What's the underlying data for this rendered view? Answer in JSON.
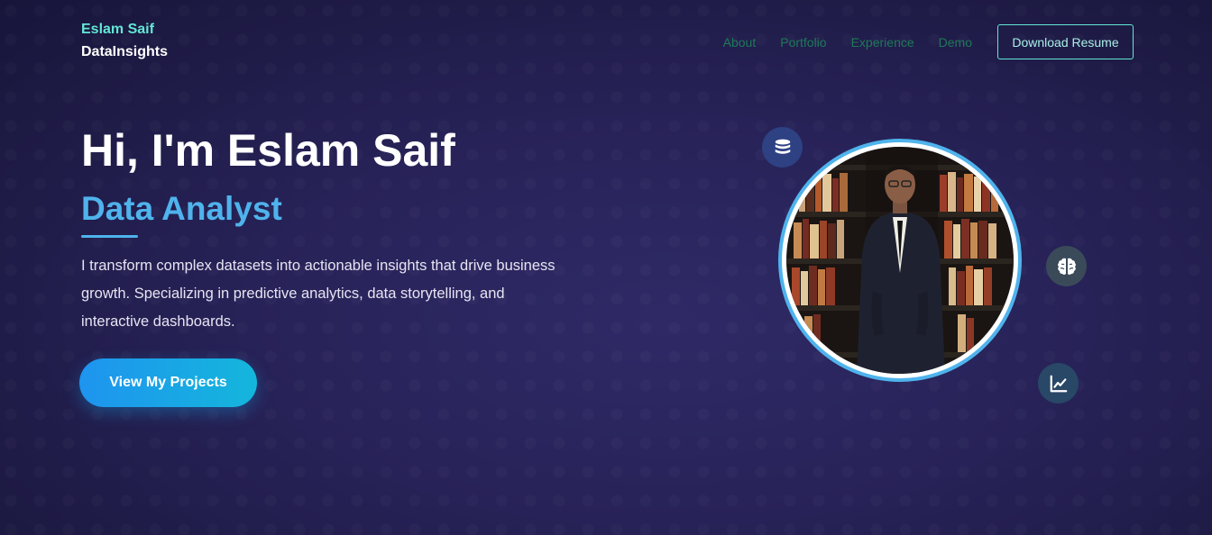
{
  "brand": {
    "name": "Eslam Saif",
    "sub": "DataInsights"
  },
  "nav": {
    "links": [
      "About",
      "Portfolio",
      "Experience",
      "Demo"
    ],
    "resume_label": "Download Resume"
  },
  "hero": {
    "title": "Hi, I'm Eslam Saif",
    "role": "Data Analyst",
    "description": "I transform complex datasets into actionable insights that drive business growth. Specializing in predictive analytics, data storytelling, and interactive dashboards.",
    "cta_label": "View My Projects"
  },
  "icons": [
    "database-icon",
    "brain-icon",
    "line-chart-icon"
  ],
  "colors": {
    "accent_teal": "#63e6d4",
    "accent_blue": "#4fb3ec",
    "nav_link": "#1d7a57",
    "background": "#272257"
  }
}
